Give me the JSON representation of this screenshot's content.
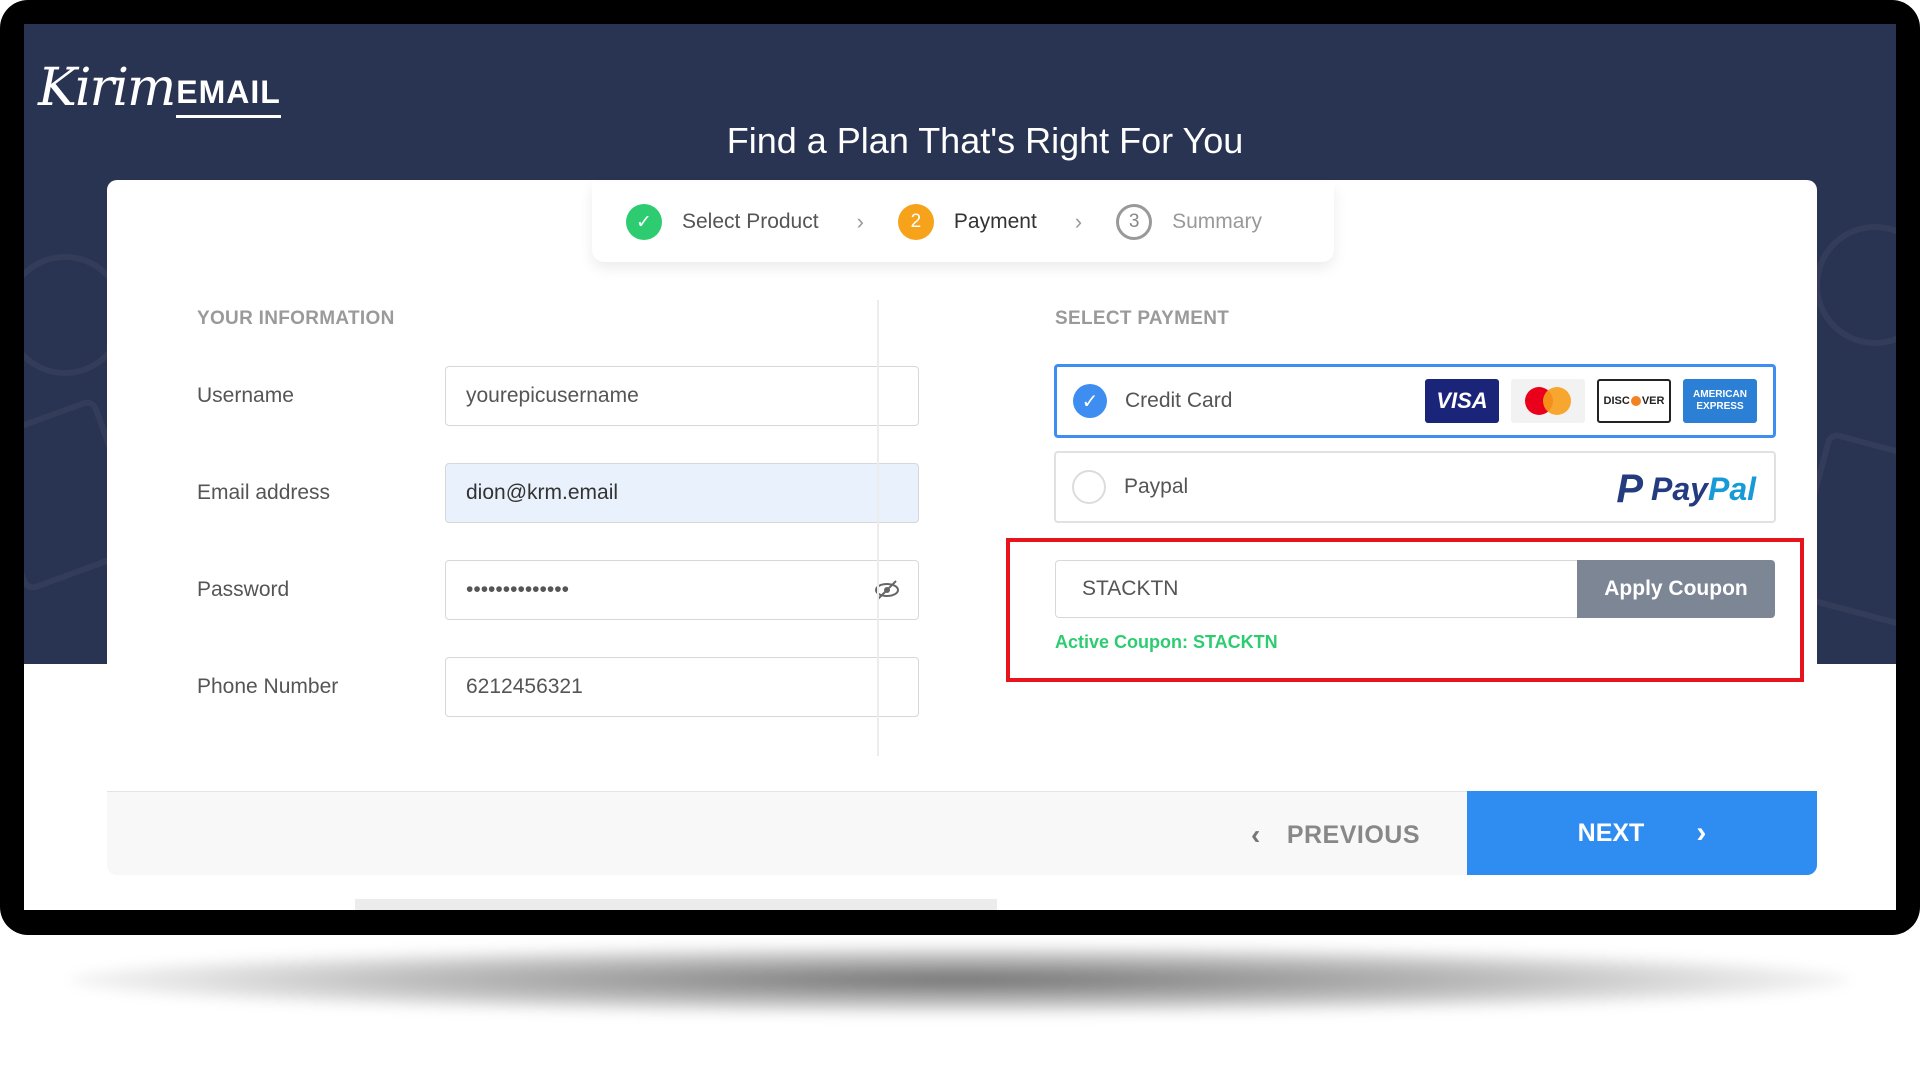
{
  "header": {
    "logo_script": "Kirim",
    "logo_caps": "EMAIL",
    "title": "Find a Plan That's Right For You"
  },
  "steps": [
    {
      "label": "Select Product",
      "state": "done",
      "icon": "check-icon",
      "marker": "✓"
    },
    {
      "label": "Payment",
      "state": "active",
      "marker": "2"
    },
    {
      "label": "Summary",
      "state": "todo",
      "marker": "3"
    }
  ],
  "step_separator": "›",
  "info": {
    "section_label": "YOUR INFORMATION",
    "username": {
      "label": "Username",
      "value": "yourepicusername"
    },
    "email": {
      "label": "Email address",
      "value": "dion@krm.email"
    },
    "password": {
      "label": "Password",
      "value": "••••••••••••••",
      "toggle_icon": "eye-slash-icon"
    },
    "phone": {
      "label": "Phone Number",
      "value": "6212456321"
    }
  },
  "payment": {
    "section_label": "SELECT PAYMENT",
    "options": [
      {
        "label": "Credit Card",
        "selected": true,
        "brands": [
          "VISA",
          "mastercard",
          "DISCOVER",
          "AMERICAN EXPRESS"
        ]
      },
      {
        "label": "Paypal",
        "selected": false,
        "brand_text_1": "Pay",
        "brand_text_2": "Pal",
        "brand_mark": "P"
      }
    ],
    "visa_text": "VISA",
    "discover_text_a": "DISC",
    "discover_text_b": "VER",
    "amex_line1": "AMERICAN",
    "amex_line2": "EXPRESS"
  },
  "coupon": {
    "value": "STACKTN",
    "apply_label": "Apply Coupon",
    "active_text": "Active Coupon: STACKTN"
  },
  "footer": {
    "previous_label": "PREVIOUS",
    "next_label": "NEXT",
    "prev_icon": "‹",
    "next_icon": "›"
  },
  "colors": {
    "hero_bg": "#293352",
    "accent_blue": "#2f8cf0",
    "step_done": "#2ecc71",
    "step_active": "#f7a21b",
    "highlight_red": "#e8141b",
    "coupon_button": "#7c8694"
  }
}
